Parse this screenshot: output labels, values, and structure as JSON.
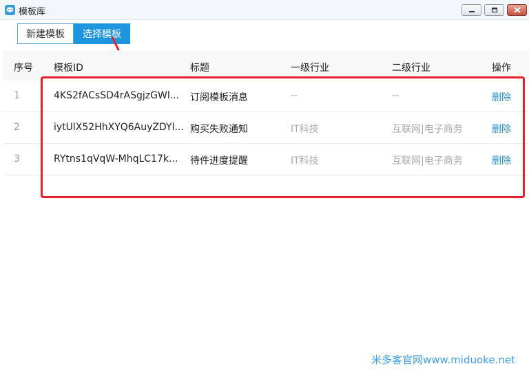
{
  "window": {
    "title": "模板库",
    "controls": [
      "minimize-icon",
      "maximize-icon",
      "close-icon"
    ]
  },
  "tabs": [
    {
      "label": "新建模板",
      "active": false
    },
    {
      "label": "选择模板",
      "active": true
    }
  ],
  "table": {
    "headers": {
      "seq": "序号",
      "id": "模板ID",
      "title": "标题",
      "industry1": "一级行业",
      "industry2": "二级行业",
      "action": "操作"
    },
    "rows": [
      {
        "seq": "1",
        "id": "4KS2fACsSD4rASgjzGWl...",
        "title": "订阅模板消息",
        "industry1": "--",
        "industry2": "--",
        "action": "删除"
      },
      {
        "seq": "2",
        "id": "iytUlX52HhXYQ6AuyZDYl...",
        "title": "购买失败通知",
        "industry1": "IT科技",
        "industry2": "互联网|电子商务",
        "action": "删除"
      },
      {
        "seq": "3",
        "id": "RYtns1qVqW-MhqLC17k...",
        "title": "待件进度提醒",
        "industry1": "IT科技",
        "industry2": "互联网|电子商务",
        "action": "删除"
      }
    ]
  },
  "annotation_color": "#e8202a",
  "accent_color": "#1e96df",
  "watermark": "米多客官网www.miduoke.net"
}
